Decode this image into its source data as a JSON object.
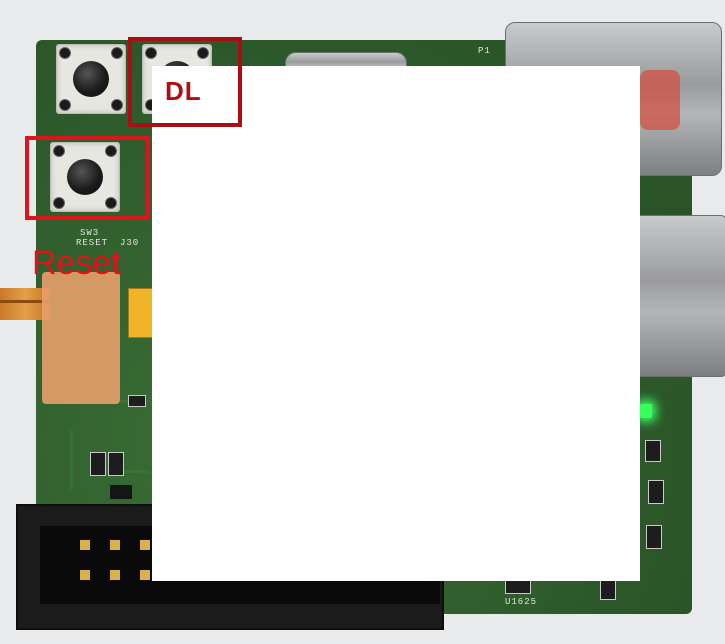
{
  "labels": {
    "dl": "DL",
    "reset": "Reset"
  },
  "silkscreen": {
    "p1": "P1",
    "sw3": "SW3",
    "reset_text": "RESET",
    "j30": "J30",
    "u1625": "U1625"
  },
  "colors": {
    "dl_box": "#a80e12",
    "reset_box": "#e0121a",
    "pcb_green": "#2f5f2c",
    "led_green": "#37ff5a"
  }
}
